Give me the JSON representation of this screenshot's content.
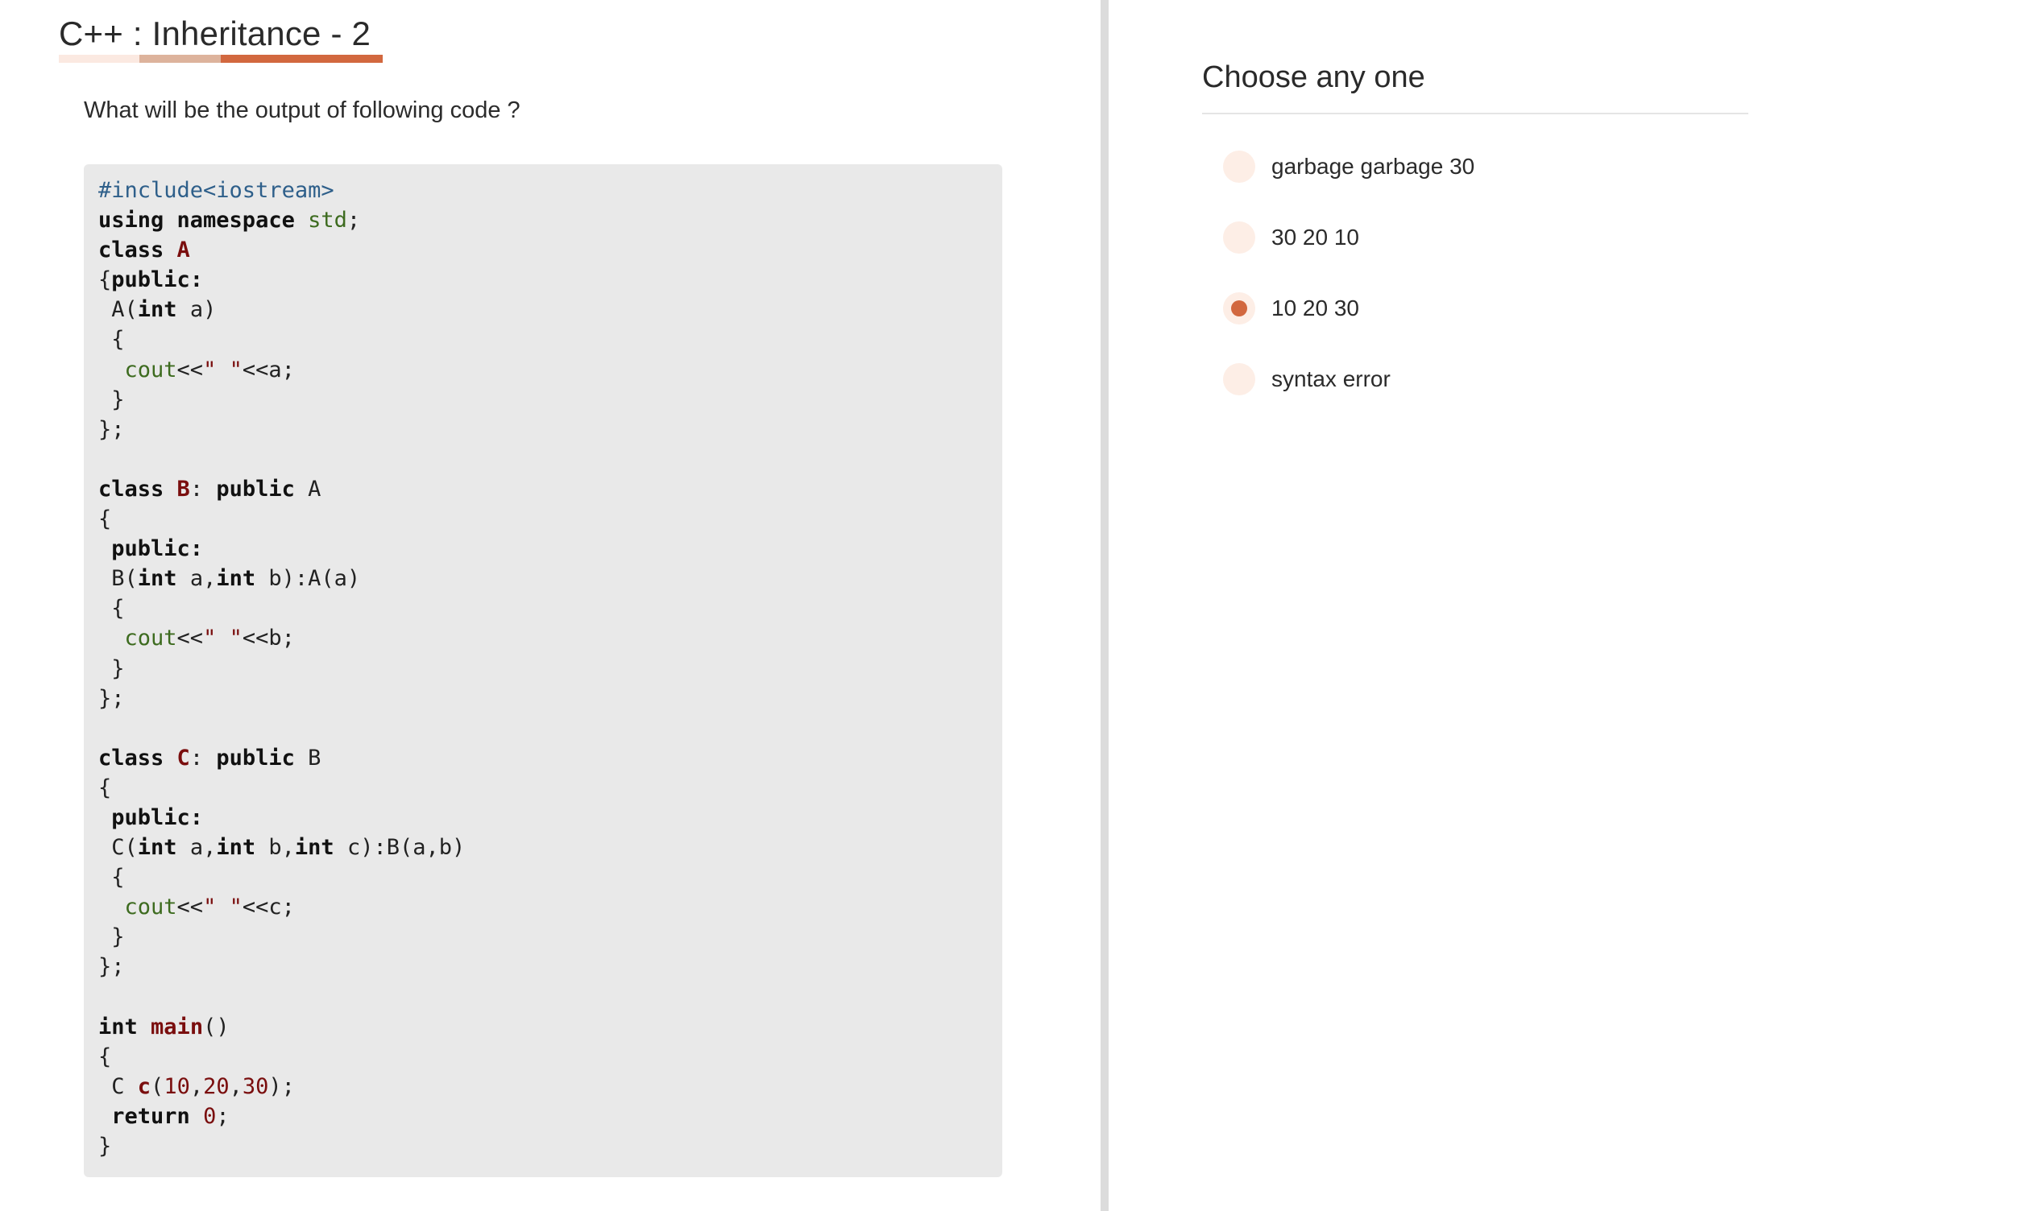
{
  "question_panel": {
    "title": "C++ : Inheritance - 2",
    "question_text": "What will be the output of following code ?",
    "accent_colors": {
      "light": "#fbe9e1",
      "mid": "#ddb39c",
      "strong": "#d2683f"
    },
    "code_lines": [
      [
        {
          "t": "#include<iostream>",
          "c": "pp"
        }
      ],
      [
        {
          "t": "using namespace",
          "c": "kw"
        },
        {
          "t": " "
        },
        {
          "t": "std",
          "c": "std"
        },
        {
          "t": ";"
        }
      ],
      [
        {
          "t": "class",
          "c": "kw"
        },
        {
          "t": " "
        },
        {
          "t": "A",
          "c": "cls"
        }
      ],
      [
        {
          "t": "{"
        },
        {
          "t": "public:",
          "c": "kw"
        }
      ],
      [
        {
          "t": " A("
        },
        {
          "t": "int",
          "c": "kw"
        },
        {
          "t": " a)"
        }
      ],
      [
        {
          "t": " {"
        }
      ],
      [
        {
          "t": "  "
        },
        {
          "t": "cout",
          "c": "cout"
        },
        {
          "t": "<<"
        },
        {
          "t": "\" \"",
          "c": "str"
        },
        {
          "t": "<<a;"
        }
      ],
      [
        {
          "t": " }"
        }
      ],
      [
        {
          "t": "};"
        }
      ],
      [
        {
          "t": ""
        }
      ],
      [
        {
          "t": "class",
          "c": "kw"
        },
        {
          "t": " "
        },
        {
          "t": "B",
          "c": "cls"
        },
        {
          "t": ": "
        },
        {
          "t": "public",
          "c": "kw"
        },
        {
          "t": " A"
        }
      ],
      [
        {
          "t": "{"
        }
      ],
      [
        {
          "t": " "
        },
        {
          "t": "public:",
          "c": "kw"
        }
      ],
      [
        {
          "t": " B("
        },
        {
          "t": "int",
          "c": "kw"
        },
        {
          "t": " a,"
        },
        {
          "t": "int",
          "c": "kw"
        },
        {
          "t": " b):A(a)"
        }
      ],
      [
        {
          "t": " {"
        }
      ],
      [
        {
          "t": "  "
        },
        {
          "t": "cout",
          "c": "cout"
        },
        {
          "t": "<<"
        },
        {
          "t": "\" \"",
          "c": "str"
        },
        {
          "t": "<<b;"
        }
      ],
      [
        {
          "t": " }"
        }
      ],
      [
        {
          "t": "};"
        }
      ],
      [
        {
          "t": ""
        }
      ],
      [
        {
          "t": "class",
          "c": "kw"
        },
        {
          "t": " "
        },
        {
          "t": "C",
          "c": "cls"
        },
        {
          "t": ": "
        },
        {
          "t": "public",
          "c": "kw"
        },
        {
          "t": " B"
        }
      ],
      [
        {
          "t": "{"
        }
      ],
      [
        {
          "t": " "
        },
        {
          "t": "public:",
          "c": "kw"
        }
      ],
      [
        {
          "t": " C("
        },
        {
          "t": "int",
          "c": "kw"
        },
        {
          "t": " a,"
        },
        {
          "t": "int",
          "c": "kw"
        },
        {
          "t": " b,"
        },
        {
          "t": "int",
          "c": "kw"
        },
        {
          "t": " c):B(a,b)"
        }
      ],
      [
        {
          "t": " {"
        }
      ],
      [
        {
          "t": "  "
        },
        {
          "t": "cout",
          "c": "cout"
        },
        {
          "t": "<<"
        },
        {
          "t": "\" \"",
          "c": "str"
        },
        {
          "t": "<<c;"
        }
      ],
      [
        {
          "t": " }"
        }
      ],
      [
        {
          "t": "};"
        }
      ],
      [
        {
          "t": ""
        }
      ],
      [
        {
          "t": "int",
          "c": "kw"
        },
        {
          "t": " "
        },
        {
          "t": "main",
          "c": "fn"
        },
        {
          "t": "()"
        }
      ],
      [
        {
          "t": "{"
        }
      ],
      [
        {
          "t": " C "
        },
        {
          "t": "c",
          "c": "fn"
        },
        {
          "t": "("
        },
        {
          "t": "10",
          "c": "num"
        },
        {
          "t": ","
        },
        {
          "t": "20",
          "c": "num"
        },
        {
          "t": ","
        },
        {
          "t": "30",
          "c": "num"
        },
        {
          "t": ");"
        }
      ],
      [
        {
          "t": " "
        },
        {
          "t": "return",
          "c": "kw"
        },
        {
          "t": " "
        },
        {
          "t": "0",
          "c": "num"
        },
        {
          "t": ";"
        }
      ],
      [
        {
          "t": "}"
        }
      ]
    ]
  },
  "answer_panel": {
    "heading": "Choose any one",
    "options": [
      {
        "label": "garbage garbage 30",
        "selected": false
      },
      {
        "label": "30 20 10",
        "selected": false
      },
      {
        "label": "10 20 30",
        "selected": true
      },
      {
        "label": "syntax error",
        "selected": false
      }
    ],
    "selected_color": "#d2683f",
    "radio_bg_color": "#fdeee6"
  }
}
